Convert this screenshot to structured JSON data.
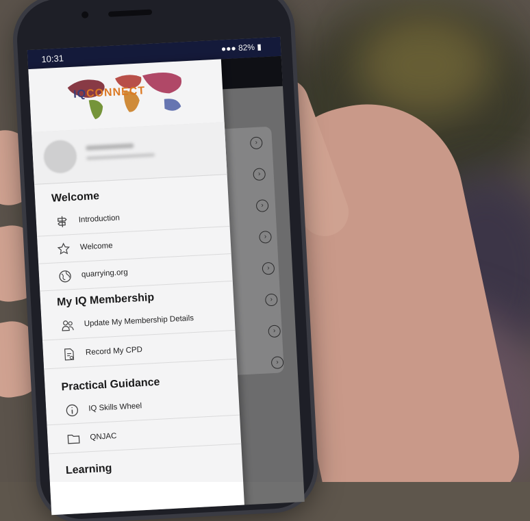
{
  "status_bar": {
    "time": "10:31",
    "battery": "82%"
  },
  "drawer": {
    "logo": {
      "text_iq": "IQ",
      "text_rest": "CONNECT"
    },
    "sections": [
      {
        "title": "Welcome",
        "items": [
          {
            "label": "Introduction",
            "icon": "signpost-icon"
          },
          {
            "label": "Welcome",
            "icon": "star-icon"
          },
          {
            "label": "quarrying.org",
            "icon": "globe-icon"
          }
        ]
      },
      {
        "title": "My IQ Membership",
        "items": [
          {
            "label": "Update My Membership Details",
            "icon": "users-icon"
          },
          {
            "label": "Record My CPD",
            "icon": "document-icon"
          }
        ]
      },
      {
        "title": "Practical Guidance",
        "items": [
          {
            "label": "IQ Skills Wheel",
            "icon": "info-icon"
          },
          {
            "label": "QNJAC",
            "icon": "folder-icon"
          }
        ]
      },
      {
        "title": "Learning",
        "items": []
      }
    ]
  },
  "colors": {
    "status_bar": "#141a3a",
    "drawer_bg": "#ffffff",
    "logo_accent": "#e67e22",
    "logo_dark": "#3a3f7a"
  }
}
